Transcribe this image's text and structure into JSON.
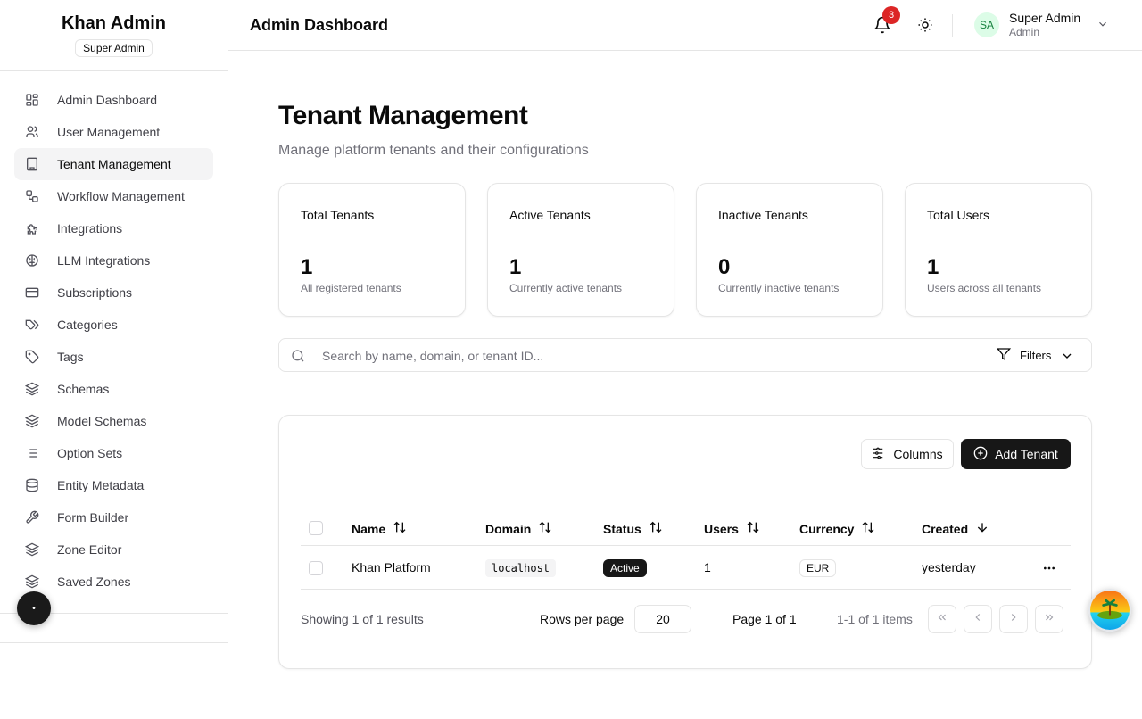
{
  "brand": {
    "title": "Khan Admin",
    "badge": "Super Admin"
  },
  "sidebar": {
    "items": [
      {
        "label": "Admin Dashboard",
        "icon": "dashboard-icon"
      },
      {
        "label": "User Management",
        "icon": "users-icon"
      },
      {
        "label": "Tenant Management",
        "icon": "building-icon",
        "active": true
      },
      {
        "label": "Workflow Management",
        "icon": "workflow-icon"
      },
      {
        "label": "Integrations",
        "icon": "puzzle-icon"
      },
      {
        "label": "LLM Integrations",
        "icon": "brain-icon"
      },
      {
        "label": "Subscriptions",
        "icon": "credit-card-icon"
      },
      {
        "label": "Categories",
        "icon": "tags-icon"
      },
      {
        "label": "Tags",
        "icon": "tag-icon"
      },
      {
        "label": "Schemas",
        "icon": "layers-icon"
      },
      {
        "label": "Model Schemas",
        "icon": "layers-icon"
      },
      {
        "label": "Option Sets",
        "icon": "list-icon"
      },
      {
        "label": "Entity Metadata",
        "icon": "database-icon"
      },
      {
        "label": "Form Builder",
        "icon": "wrench-icon"
      },
      {
        "label": "Zone Editor",
        "icon": "layers-icon"
      },
      {
        "label": "Saved Zones",
        "icon": "layers-icon"
      }
    ]
  },
  "header": {
    "title": "Admin Dashboard",
    "notification_count": "3",
    "user": {
      "initials": "SA",
      "name": "Super Admin",
      "role": "Admin"
    }
  },
  "page": {
    "title": "Tenant Management",
    "subtitle": "Manage platform tenants and their configurations"
  },
  "stats": [
    {
      "label": "Total Tenants",
      "value": "1",
      "desc": "All registered tenants"
    },
    {
      "label": "Active Tenants",
      "value": "1",
      "desc": "Currently active tenants"
    },
    {
      "label": "Inactive Tenants",
      "value": "0",
      "desc": "Currently inactive tenants"
    },
    {
      "label": "Total Users",
      "value": "1",
      "desc": "Users across all tenants"
    }
  ],
  "search": {
    "placeholder": "Search by name, domain, or tenant ID...",
    "value": ""
  },
  "filters": {
    "label": "Filters"
  },
  "toolbar": {
    "columns_label": "Columns",
    "add_label": "Add Tenant"
  },
  "table": {
    "headers": [
      "Name",
      "Domain",
      "Status",
      "Users",
      "Currency",
      "Created"
    ],
    "rows": [
      {
        "name": "Khan Platform",
        "domain": "localhost",
        "status": "Active",
        "users": "1",
        "currency": "EUR",
        "created": "yesterday"
      }
    ]
  },
  "pagination": {
    "showing": "Showing 1 of 1 results",
    "rows_per_page_label": "Rows per page",
    "rows_per_page": "20",
    "page_label": "Page 1 of 1",
    "items_label": "1-1 of 1 items"
  }
}
